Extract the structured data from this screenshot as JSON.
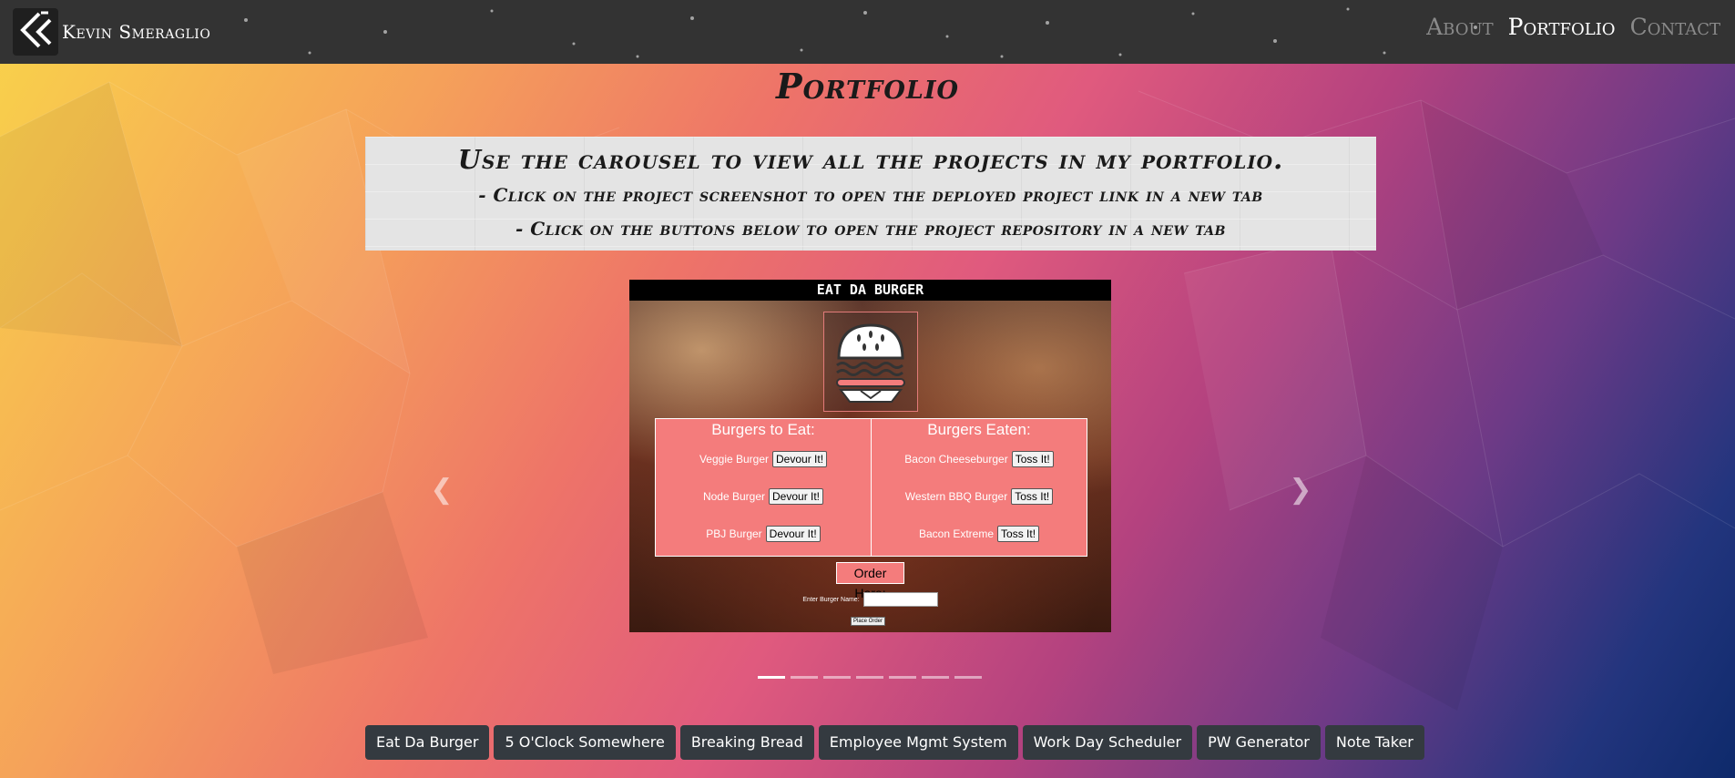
{
  "nav": {
    "brand": "Kevin Smeraglio",
    "links": [
      {
        "label": "About",
        "active": false
      },
      {
        "label": "Portfolio",
        "active": true
      },
      {
        "label": "Contact",
        "active": false
      }
    ]
  },
  "page": {
    "title": "Portfolio"
  },
  "info": {
    "main": "Use the carousel to view all the projects in my portfolio.",
    "line1": "- Click on the project screenshot to open the deployed project link in a new tab",
    "line2": "- Click on the buttons below to open the project repository in a new tab"
  },
  "carousel": {
    "slide": {
      "header": "EAT DA BURGER",
      "left_title": "Burgers to Eat:",
      "right_title": "Burgers Eaten:",
      "to_eat": [
        {
          "name": "Veggie Burger",
          "button": "Devour It!"
        },
        {
          "name": "Node Burger",
          "button": "Devour It!"
        },
        {
          "name": "PBJ Burger",
          "button": "Devour It!"
        }
      ],
      "eaten": [
        {
          "name": "Bacon Cheeseburger",
          "button": "Toss It!"
        },
        {
          "name": "Western BBQ Burger",
          "button": "Toss It!"
        },
        {
          "name": "Bacon Extreme",
          "button": "Toss It!"
        }
      ],
      "order_here": "Order Here:",
      "enter_label": "Enter Burger Name:",
      "place_order": "Place Order"
    },
    "indicator_count": 7,
    "active_index": 0
  },
  "projects": [
    "Eat Da Burger",
    "5 O'Clock Somewhere",
    "Breaking Bread",
    "Employee Mgmt System",
    "Work Day Scheduler",
    "PW Generator",
    "Note Taker"
  ],
  "colors": {
    "navbar": "#333333",
    "button": "#343a40",
    "panel": "#f47c7c"
  }
}
